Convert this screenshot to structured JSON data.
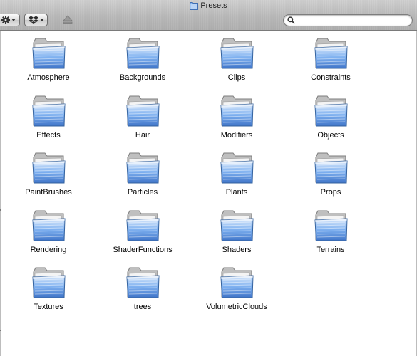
{
  "window": {
    "title": "Presets"
  },
  "toolbar": {
    "action_icon": "gear-icon",
    "dropbox_icon": "dropbox-icon",
    "eject_icon": "eject-icon",
    "search": {
      "value": "",
      "icon": "search-icon"
    }
  },
  "folders": [
    {
      "label": "Atmosphere"
    },
    {
      "label": "Backgrounds"
    },
    {
      "label": "Clips"
    },
    {
      "label": "Constraints"
    },
    {
      "label": "Effects"
    },
    {
      "label": "Hair"
    },
    {
      "label": "Modifiers"
    },
    {
      "label": "Objects"
    },
    {
      "label": "PaintBrushes"
    },
    {
      "label": "Particles"
    },
    {
      "label": "Plants"
    },
    {
      "label": "Props"
    },
    {
      "label": "Rendering"
    },
    {
      "label": "ShaderFunctions"
    },
    {
      "label": "Shaders"
    },
    {
      "label": "Terrains"
    },
    {
      "label": "Textures"
    },
    {
      "label": "trees"
    },
    {
      "label": "VolumetricClouds"
    }
  ],
  "colors": {
    "folder_blue": "#7fb1f0",
    "folder_light": "#dbe9fb",
    "folder_dark": "#3f74c8"
  }
}
